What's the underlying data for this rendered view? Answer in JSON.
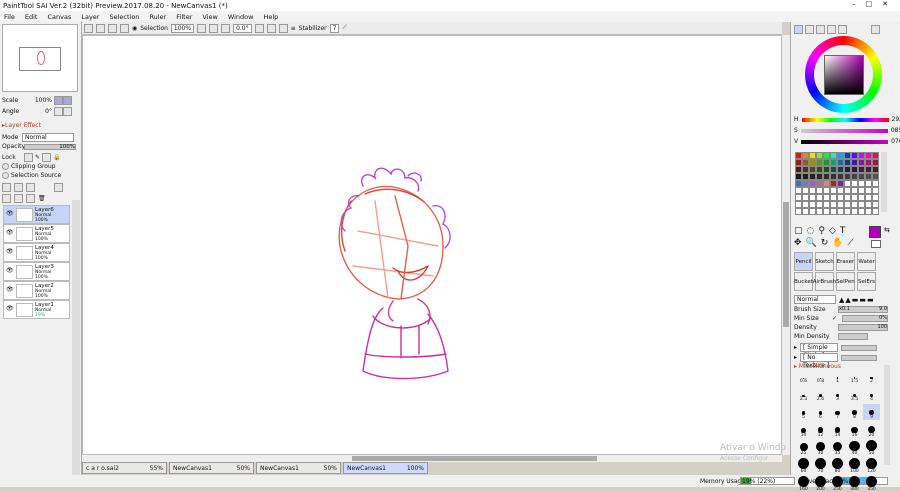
{
  "app": {
    "title": "PaintTool SAI Ver.2 (32bit) Preview.2017.08.20 - NewCanvas1 (*)"
  },
  "menu": [
    "File",
    "Edit",
    "Canvas",
    "Layer",
    "Selection",
    "Ruler",
    "Filter",
    "View",
    "Window",
    "Help"
  ],
  "toolbar": {
    "selection_label": "Selection",
    "zoom": "100%",
    "angle": "0.0°",
    "stabilizer_label": "Stabilizer",
    "stabilizer_value": "7"
  },
  "left": {
    "scale_label": "Scale",
    "scale_value": "100%",
    "angle_label": "Angle",
    "angle_value": "0°",
    "layer_effect": "Layer Effect",
    "mode_label": "Mode",
    "mode_value": "Normal",
    "opacity_label": "Opacity",
    "opacity_value": "100%",
    "lock_label": "Lock",
    "clipping_group": "Clipping Group",
    "selection_source": "Selection Source",
    "layers": [
      {
        "name": "Layer6",
        "mode": "Normal",
        "opacity": "100%",
        "selected": true
      },
      {
        "name": "Layer5",
        "mode": "Normal",
        "opacity": "100%"
      },
      {
        "name": "Layer4",
        "mode": "Normal",
        "opacity": "100%"
      },
      {
        "name": "Layer3",
        "mode": "Normal",
        "opacity": "100%"
      },
      {
        "name": "Layer2",
        "mode": "Normal",
        "opacity": "100%"
      },
      {
        "name": "Layer1",
        "mode": "Normal",
        "opacity": "19%"
      }
    ]
  },
  "tabs": [
    {
      "name": "c a r o.sai2",
      "zoom": "55%"
    },
    {
      "name": "NewCanvas1",
      "zoom": "50%"
    },
    {
      "name": "NewCanvas1",
      "zoom": "50%"
    },
    {
      "name": "NewCanvas1",
      "zoom": "100%",
      "active": true
    }
  ],
  "status": {
    "memory_label": "Memory Usage",
    "memory_value": "19% (22%)",
    "drive_label": "Drive Space",
    "drive_value": "76%"
  },
  "watermark": {
    "line1": "Ativar o Windo",
    "line2": "Acesse Configur"
  },
  "color": {
    "h_label": "H",
    "h_value": "293",
    "s_label": "S",
    "s_value": "085",
    "v_label": "V",
    "v_value": "076",
    "current": "#b000c0"
  },
  "tools": [
    {
      "label": "Pencil",
      "selected": true
    },
    {
      "label": "Sketch"
    },
    {
      "label": "Eraser"
    },
    {
      "label": "Water"
    },
    {
      "label": "Bucket"
    },
    {
      "label": "AirBrush"
    },
    {
      "label": "SelPen"
    },
    {
      "label": "SelErs"
    }
  ],
  "brush": {
    "blend_mode": "Normal",
    "size_label": "Brush Size",
    "size_mult": "x0.1",
    "size_value": "9.0",
    "min_size_label": "Min Size",
    "min_size_value": "0%",
    "density_label": "Density",
    "density_value": "100",
    "min_density_label": "Min Density",
    "shape": "[ Simple Circle ]",
    "texture": "[ No Texture ]",
    "misc_label": "Miscellaneous",
    "sizes": [
      "0.6",
      "0.8",
      "1",
      "1.5",
      "2",
      "2.3",
      "2.6",
      "3",
      "3.5",
      "4",
      "5",
      "6",
      "7",
      "8",
      "9",
      "10",
      "12",
      "14",
      "16",
      "20",
      "25",
      "30",
      "35",
      "40",
      "50",
      "60",
      "70",
      "80",
      "100",
      "120",
      "160",
      "200",
      "250",
      "300",
      "350"
    ]
  }
}
